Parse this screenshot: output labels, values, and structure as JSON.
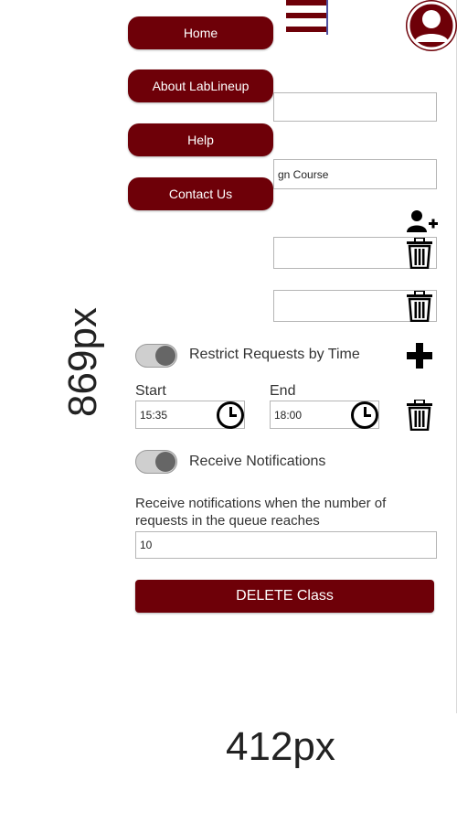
{
  "nav": {
    "menu_items": [
      "Home",
      "About LabLineup",
      "Help",
      "Contact Us"
    ]
  },
  "form": {
    "course_input_partial": "gn Course",
    "restrict_label": "Restrict Requests by Time",
    "start_label": "Start",
    "end_label": "End",
    "start_value": "15:35",
    "end_value": "18:00",
    "notifications_label": "Receive Notifications",
    "threshold_label_line1": "Receive notifications when the number of",
    "threshold_label_line2": "requests in the queue reaches",
    "threshold_value": "10",
    "delete_label": "DELETE Class"
  },
  "annotations": {
    "height_label": "869px",
    "width_label": "412px"
  },
  "colors": {
    "brand": "#6e0008",
    "toggle_track": "#cfcfcf",
    "toggle_knob": "#666666"
  },
  "icons": [
    "hamburger-icon",
    "user-avatar-icon",
    "add-user-icon",
    "trash-icon",
    "plus-icon",
    "clock-icon"
  ]
}
